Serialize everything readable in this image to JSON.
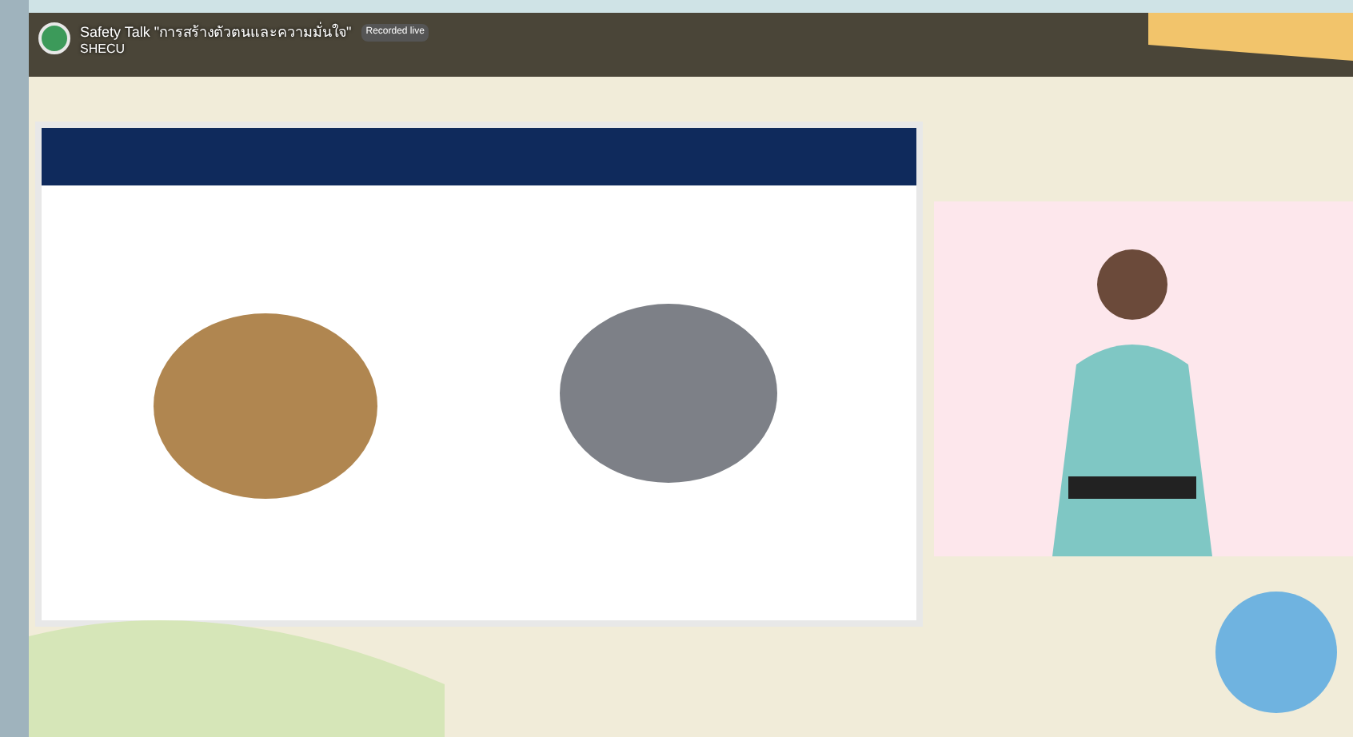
{
  "video": {
    "kind": "picture",
    "title": "Safety Talk \"การสร้างตัวตนและความมั่นใจ\"",
    "badge": "Recorded live",
    "channel": "SHECU"
  }
}
